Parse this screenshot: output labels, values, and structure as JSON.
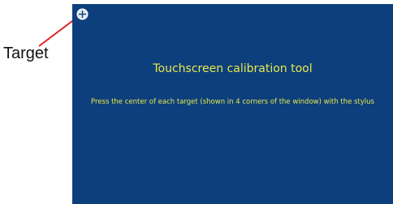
{
  "annotation": {
    "label": "Target",
    "line_color": "#e02020"
  },
  "calibration_window": {
    "background_color": "#0d3f7d",
    "text_color": "#e8e84a",
    "title": "Touchscreen calibration tool",
    "instructions": "Press the center of each target (shown in 4 corners of the window) with the stylus",
    "target_icon": "crosshair-circle-icon"
  }
}
